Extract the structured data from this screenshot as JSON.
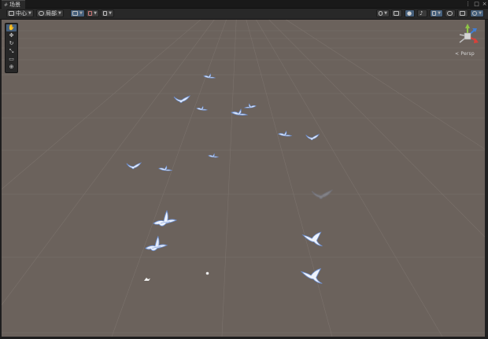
{
  "window": {
    "tab_label": "场景",
    "menu_glyph": "⋮",
    "maximize_glyph": "□",
    "close_glyph": "×"
  },
  "toolbar": {
    "pivot_label": "中心",
    "space_label": "局部",
    "render_mode_active": true,
    "lighting_active": true
  },
  "tools": [
    {
      "name": "hand-tool",
      "glyph": "✋",
      "active": true
    },
    {
      "name": "move-tool",
      "glyph": "✥",
      "active": false
    },
    {
      "name": "rotate-tool",
      "glyph": "↻",
      "active": false
    },
    {
      "name": "scale-tool",
      "glyph": "⤡",
      "active": false
    },
    {
      "name": "rect-tool",
      "glyph": "▭",
      "active": false
    },
    {
      "name": "transform-tool",
      "glyph": "⊕",
      "active": false
    }
  ],
  "scene": {
    "projection_label": "< Persp",
    "background_color": "#6b625c",
    "gizmo_colors": {
      "x": "#d8413a",
      "y": "#8ec546",
      "z": "#3f7fd8"
    }
  },
  "icons": {
    "scene-tab": "hash-icon",
    "draw-mode": "draw-mode-icon",
    "2d-toggle": "2d-icon",
    "lighting": "light-bulb-icon",
    "audio": "audio-icon",
    "effects": "effects-icon",
    "hidden-objects": "eye-icon",
    "gizmos": "gizmo-icon"
  }
}
